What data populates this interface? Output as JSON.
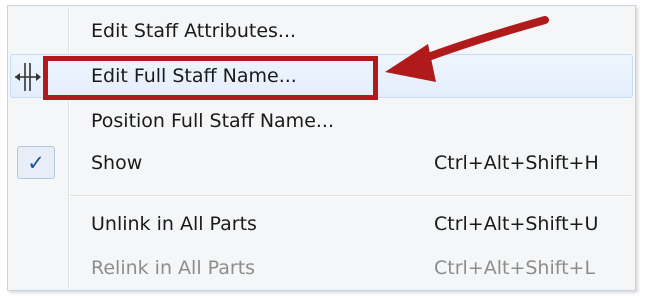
{
  "menu": {
    "items": [
      {
        "label": "Edit Staff Attributes...",
        "shortcut": "",
        "enabled": true,
        "checked": false
      },
      {
        "label": "Edit Full Staff Name...",
        "shortcut": "",
        "enabled": true,
        "checked": false,
        "highlighted": true
      },
      {
        "label": "Position Full Staff Name...",
        "shortcut": "",
        "enabled": true,
        "checked": false
      },
      {
        "label": "Show",
        "shortcut": "Ctrl+Alt+Shift+H",
        "enabled": true,
        "checked": true
      },
      {
        "label": "Unlink in All Parts",
        "shortcut": "Ctrl+Alt+Shift+U",
        "enabled": true,
        "checked": false
      },
      {
        "label": "Relink in All Parts",
        "shortcut": "Ctrl+Alt+Shift+L",
        "enabled": false,
        "checked": false
      }
    ],
    "checkmark_glyph": "✓"
  },
  "annotation": {
    "color": "#b11a1a"
  },
  "icons": {
    "cursor": "column-resize-cursor-icon",
    "checkmark": "checkmark-icon",
    "arrow": "annotation-arrow-icon"
  }
}
